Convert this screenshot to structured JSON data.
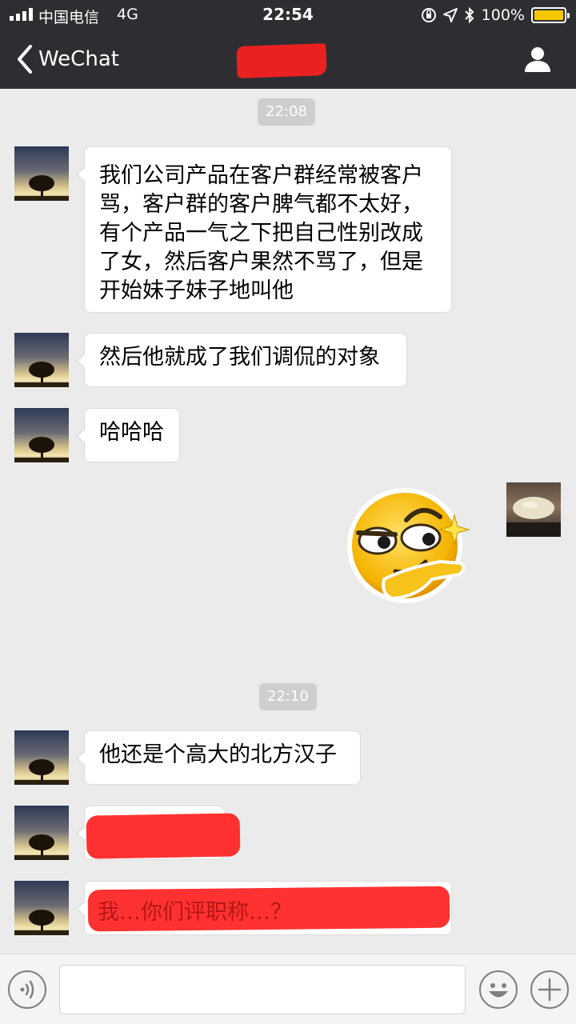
{
  "status_bar": {
    "carrier": "中国电信",
    "network": "4G",
    "time": "22:54",
    "battery": "100%",
    "battery_level": 1.0,
    "battery_color": "#f6c700"
  },
  "nav": {
    "back_label": "WeChat",
    "icons": {
      "back": "chevron-left-icon",
      "profile": "person-icon"
    }
  },
  "messages": [
    {
      "type": "timestamp",
      "text": "22:08"
    },
    {
      "type": "text",
      "side": "left",
      "text": "我们公司产品在客户群经常被客户\n骂，客户群的客户脾气都不太好，\n有个产品一气之下把自己性别改成\n了女，然后客户果然不骂了，但是\n开始妹子妹子地叫他"
    },
    {
      "type": "text",
      "side": "left",
      "text": "然后他就成了我们调侃的对象"
    },
    {
      "type": "text",
      "side": "left",
      "text": "哈哈哈"
    },
    {
      "type": "sticker",
      "side": "right",
      "sticker": "smirk-emoji-pointing"
    },
    {
      "type": "timestamp",
      "text": "22:10"
    },
    {
      "type": "text",
      "side": "left",
      "text": "他还是个高大的北方汉子"
    },
    {
      "type": "text",
      "side": "left",
      "redacted": true,
      "text": ""
    },
    {
      "type": "text",
      "side": "left",
      "redacted": true,
      "text": "我…你们评职称…？"
    }
  ],
  "input_bar": {
    "icons": {
      "voice": "voice-icon",
      "emoji": "emoji-icon",
      "more": "plus-icon"
    }
  },
  "colors": {
    "header_bg": "#2e2e32",
    "chat_bg": "#ebebeb",
    "bubble_bg": "#ffffff",
    "redaction": "#ff1f1f"
  }
}
